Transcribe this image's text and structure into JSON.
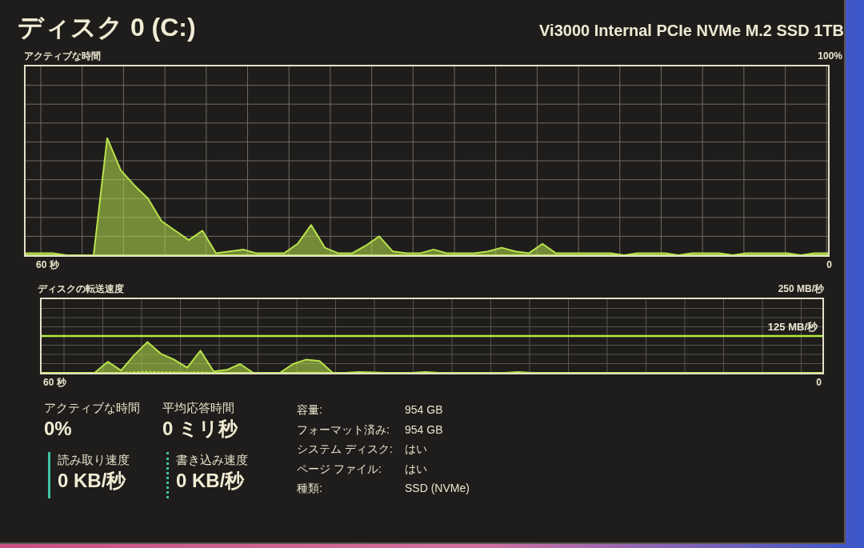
{
  "header": {
    "title": "ディスク 0 (C:)",
    "model": "Vi3000 Internal PCIe NVMe M.2 SSD 1TB"
  },
  "graphs": [
    {
      "kind": "active_time",
      "title": "アクティブな時間",
      "max_label": "100%",
      "time_label": "60 秒",
      "min_label": "0"
    },
    {
      "kind": "transfer_rate",
      "title": "ディスクの転送速度",
      "max_label": "250 MB/秒",
      "line_label": "125 MB/秒",
      "time_label": "60 秒",
      "min_label": "0"
    }
  ],
  "stats": [
    {
      "kind": "plain",
      "label": "アクティブな時間",
      "value": "0%"
    },
    {
      "kind": "plain",
      "label": "平均応答時間",
      "value": "0 ミリ秒"
    },
    {
      "kind": "solid_legend",
      "label": "読み取り速度",
      "value": "0 KB/秒"
    },
    {
      "kind": "dotted_legend",
      "label": "書き込み速度",
      "value": "0 KB/秒"
    }
  ],
  "properties": [
    {
      "label": "容量:",
      "value": "954 GB"
    },
    {
      "label": "フォーマット済み:",
      "value": "954 GB"
    },
    {
      "label": "システム ディスク:",
      "value": "はい"
    },
    {
      "label": "ページ ファイル:",
      "value": "はい"
    },
    {
      "label": "種類:",
      "value": "SSD (NVMe)"
    }
  ]
}
